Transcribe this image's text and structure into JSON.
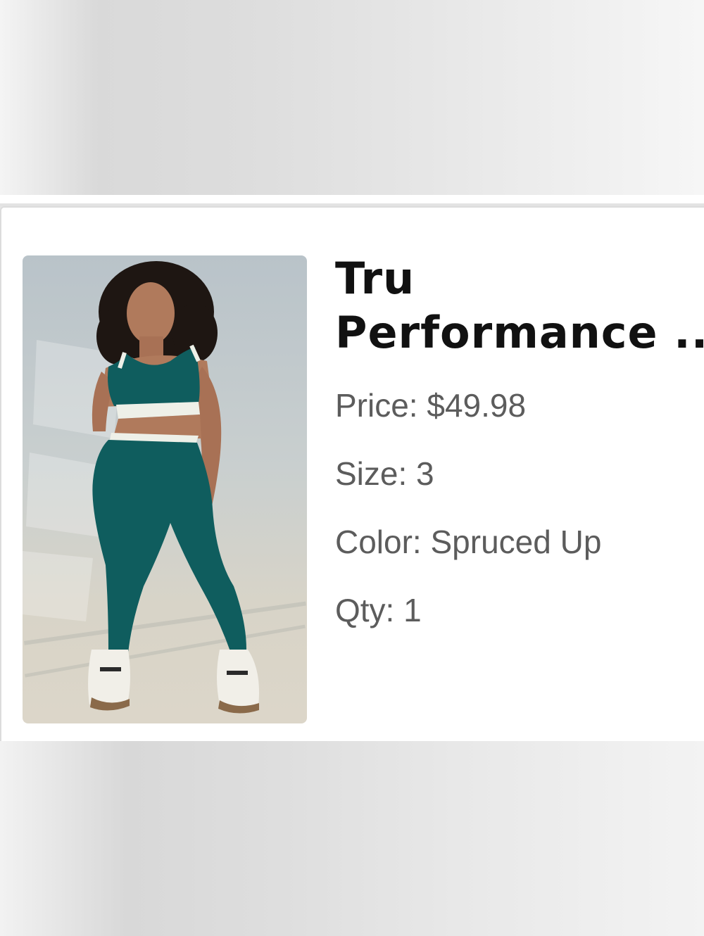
{
  "product": {
    "title_line1": "Tru",
    "title_line2": "Performance ...",
    "price_label": "Price:",
    "price_value": "$49.98",
    "size_label": "Size:",
    "size_value": "3",
    "color_label": "Color:",
    "color_value": "Spruced Up",
    "qty_label": "Qty:",
    "qty_value": "1",
    "image": {
      "subject": "model-in-teal-activewear",
      "outfit_color": "#0f5d5e",
      "trim_color": "#eef0e8"
    }
  }
}
